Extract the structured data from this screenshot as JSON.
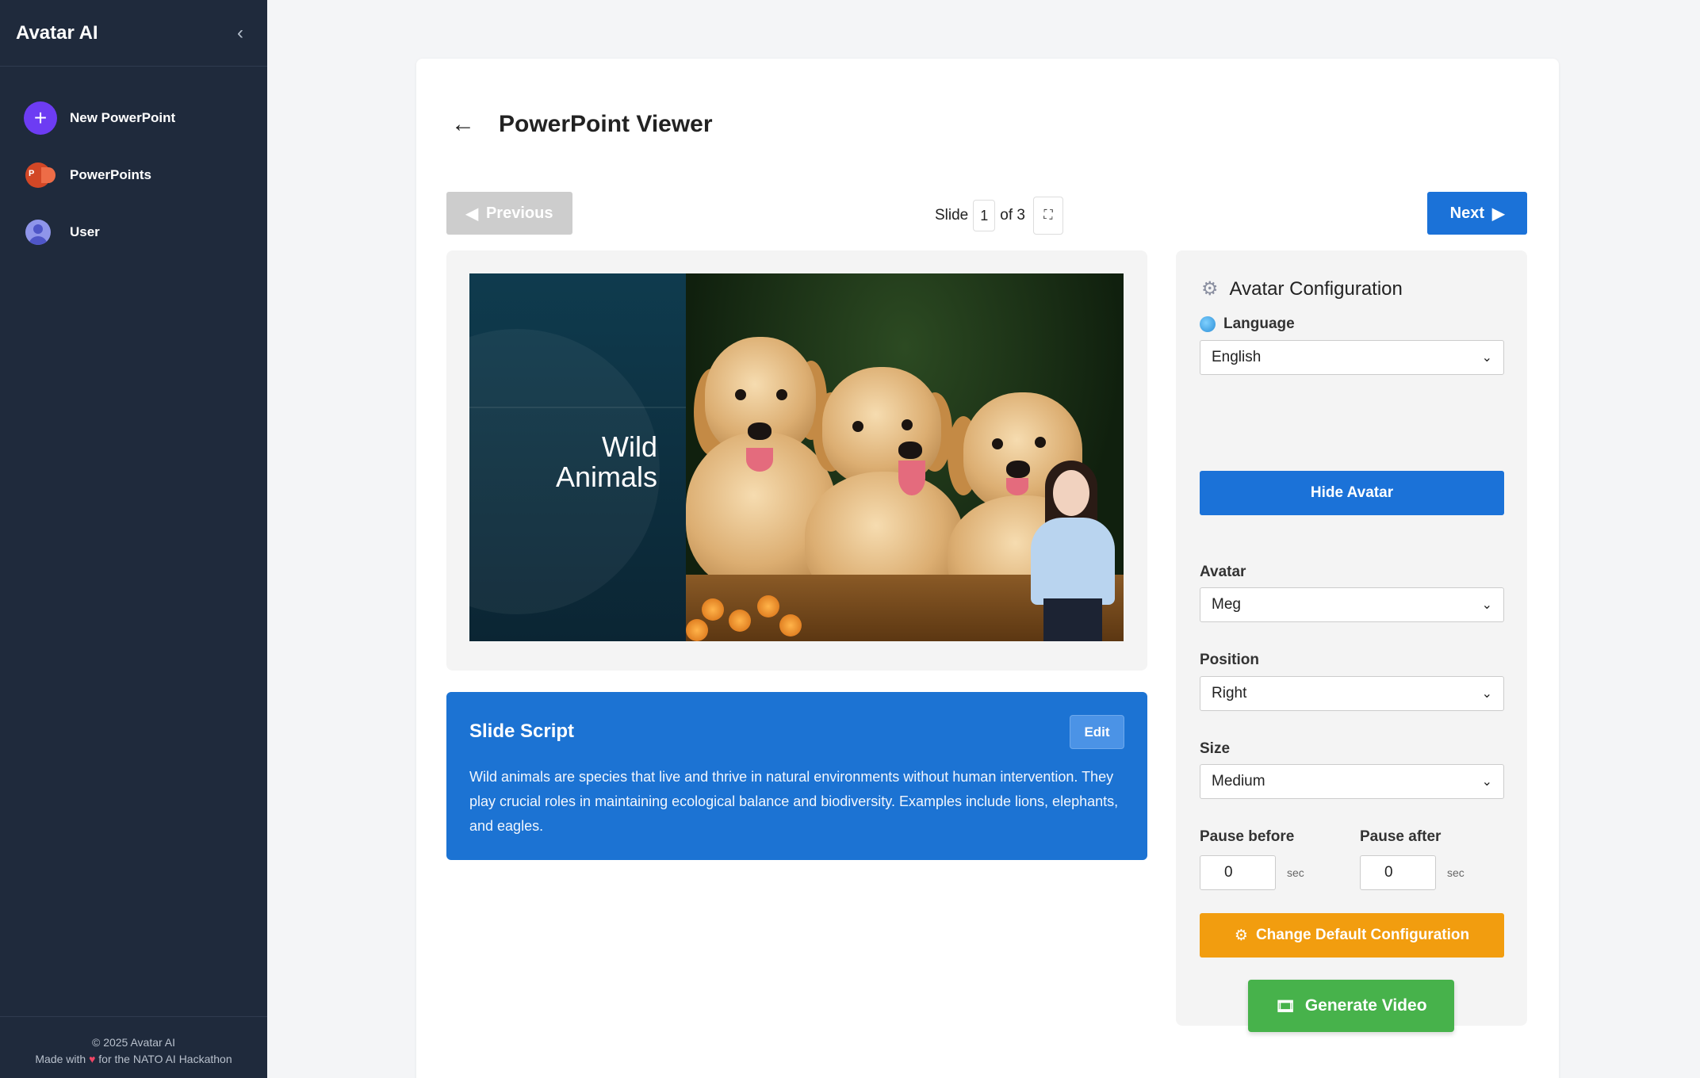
{
  "sidebar": {
    "title": "Avatar AI",
    "collapse_icon": "chevron-left-icon",
    "items": [
      {
        "label": "New PowerPoint",
        "icon": "plus-icon"
      },
      {
        "label": "PowerPoints",
        "icon": "powerpoint-icon"
      },
      {
        "label": "User",
        "icon": "user-icon"
      }
    ],
    "footer": {
      "copyright": "© 2025 Avatar AI",
      "made_with": "Made with",
      "made_for": "for the NATO AI Hackathon"
    }
  },
  "header": {
    "back_icon": "arrow-left-icon",
    "title": "PowerPoint Viewer"
  },
  "navigation": {
    "previous_label": "Previous",
    "next_label": "Next",
    "slide_prefix": "Slide",
    "current_slide": "1",
    "total_label": "of 3"
  },
  "slide": {
    "title_line1": "Wild",
    "title_line2": "Animals"
  },
  "script": {
    "title": "Slide Script",
    "edit_label": "Edit",
    "text": "Wild animals are species that live and thrive in natural environments without human intervention. They play crucial roles in maintaining ecological balance and biodiversity. Examples include lions, elephants, and eagles."
  },
  "config": {
    "title": "Avatar Configuration",
    "language_label": "Language",
    "language_value": "English",
    "hide_avatar_label": "Hide Avatar",
    "avatar_label": "Avatar",
    "avatar_value": "Meg",
    "position_label": "Position",
    "position_value": "Right",
    "size_label": "Size",
    "size_value": "Medium",
    "pause_before_label": "Pause before",
    "pause_before_value": "0",
    "pause_after_label": "Pause after",
    "pause_after_value": "0",
    "unit_label": "sec",
    "change_default_label": "Change Default Configuration",
    "generate_label": "Generate Video"
  },
  "colors": {
    "sidebar_bg": "#1f2a3c",
    "primary_blue": "#1b72d8",
    "orange": "#f29d0f",
    "green": "#47b24b",
    "purple": "#6d3cf3"
  }
}
